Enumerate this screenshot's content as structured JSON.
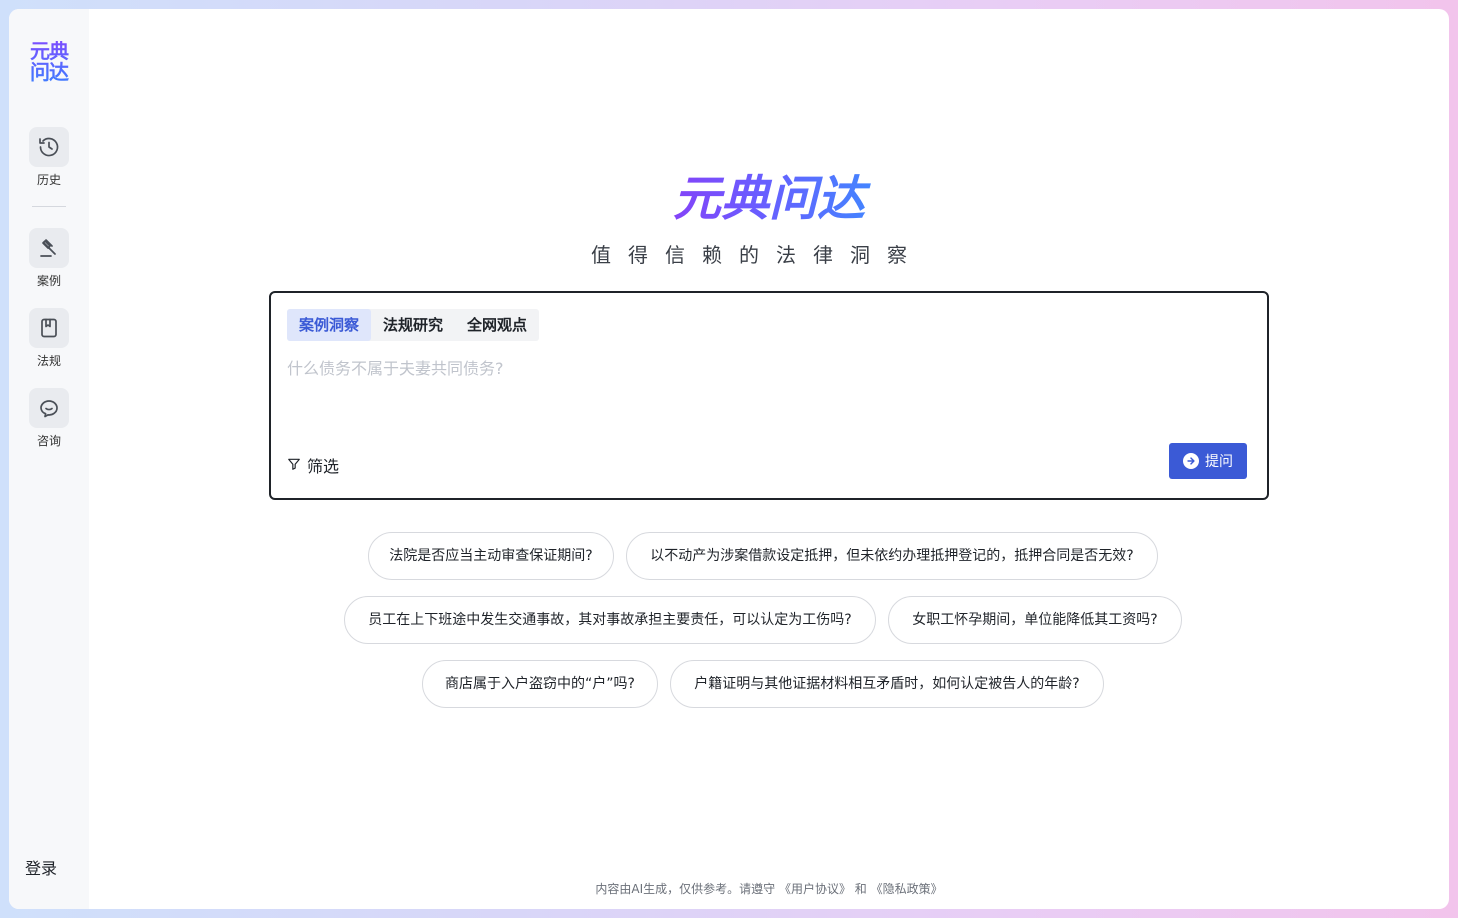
{
  "sidebar": {
    "logo": "元典问达",
    "items": [
      {
        "label": "历史",
        "icon": "history-icon"
      },
      {
        "label": "案例",
        "icon": "gavel-icon"
      },
      {
        "label": "法规",
        "icon": "book-icon"
      },
      {
        "label": "咨询",
        "icon": "chat-icon"
      }
    ],
    "login_label": "登录"
  },
  "hero": {
    "brand": "元典问达",
    "tagline": "值得信赖的法律洞察"
  },
  "search": {
    "tabs": [
      {
        "label": "案例洞察",
        "active": true
      },
      {
        "label": "法规研究",
        "active": false
      },
      {
        "label": "全网观点",
        "active": false
      }
    ],
    "placeholder": "什么债务不属于夫妻共同债务?",
    "value": "",
    "filter_label": "筛选",
    "submit_label": "提问"
  },
  "suggestions": [
    "法院是否应当主动审查保证期间?",
    "以不动产为涉案借款设定抵押，但未依约办理抵押登记的，抵押合同是否无效?",
    "员工在上下班途中发生交通事故，其对事故承担主要责任，可以认定为工伤吗?",
    "女职工怀孕期间，单位能降低其工资吗?",
    "商店属于入户盗窃中的“户”吗?",
    "户籍证明与其他证据材料相互矛盾时，如何认定被告人的年龄?"
  ],
  "footer": {
    "disclaimer": "内容由AI生成，仅供参考。请遵守",
    "user_agreement": "《用户协议》",
    "and": "和",
    "privacy_policy": "《隐私政策》"
  },
  "colors": {
    "accent": "#3b5ad6",
    "active_tab_bg": "#dfe6fb",
    "sidebar_bg": "#f7f8fa"
  }
}
